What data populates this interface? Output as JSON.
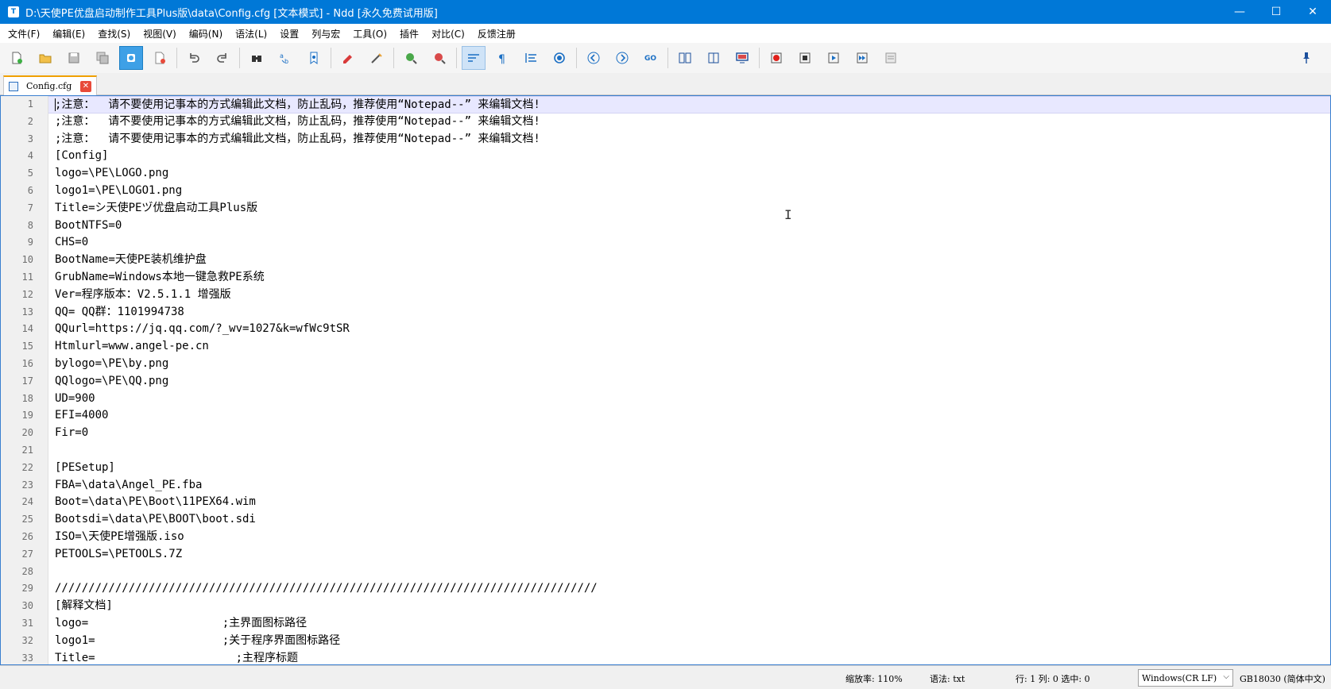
{
  "window": {
    "title": "D:\\天使PE优盘启动制作工具Plus版\\data\\Config.cfg [文本模式] - Ndd [永久免费试用版]",
    "app_icon": "T",
    "minimize": "—",
    "maximize": "☐",
    "close": "✕"
  },
  "menu": [
    "文件(F)",
    "编辑(E)",
    "查找(S)",
    "视图(V)",
    "编码(N)",
    "语法(L)",
    "设置",
    "列与宏",
    "工具(O)",
    "插件",
    "对比(C)",
    "反馈注册"
  ],
  "toolbar": {
    "icons": [
      "new-file-icon",
      "open-file-icon",
      "save-icon",
      "save-all-icon",
      "close-file-icon",
      "close-all-icon",
      "undo-icon",
      "redo-icon",
      "find-icon",
      "replace-icon",
      "bookmark-icon",
      "mark-icon",
      "clear-mark-icon",
      "zoom-in-icon",
      "zoom-out-icon",
      "word-wrap-icon",
      "show-symbols-icon",
      "indent-guide-icon",
      "file-monitor-icon",
      "prev-icon",
      "next-icon",
      "goto-icon",
      "compare-dir-icon",
      "compare-file-icon",
      "display-icon",
      "record-macro-icon",
      "stop-macro-icon",
      "play-macro-icon",
      "run-macro-multiple-icon",
      "save-macro-icon",
      "pin-icon"
    ]
  },
  "tab": {
    "label": "Config.cfg",
    "close": "✕"
  },
  "editor": {
    "lines": [
      ";注意：  请不要使用记事本的方式编辑此文档，防止乱码，推荐使用“Notepad--” 来编辑文档!",
      ";注意：  请不要使用记事本的方式编辑此文档，防止乱码，推荐使用“Notepad--” 来编辑文档!",
      ";注意：  请不要使用记事本的方式编辑此文档，防止乱码，推荐使用“Notepad--” 来编辑文档!",
      "[Config]",
      "logo=\\PE\\LOGO.png",
      "logo1=\\PE\\LOGO1.png",
      "Title=シ天使PEヅ优盘启动工具Plus版",
      "BootNTFS=0",
      "CHS=0",
      "BootName=天使PE装机维护盘",
      "GrubName=Windows本地一键急救PE系统",
      "Ver=程序版本：V2.5.1.1 增强版",
      "QQ= QQ群：1101994738",
      "QQurl=https://jq.qq.com/?_wv=1027&k=wfWc9tSR",
      "Htmlurl=www.angel-pe.cn",
      "bylogo=\\PE\\by.png",
      "QQlogo=\\PE\\QQ.png",
      "UD=900",
      "EFI=4000",
      "Fir=0",
      "",
      "[PESetup]",
      "FBA=\\data\\Angel_PE.fba",
      "Boot=\\data\\PE\\Boot\\11PEX64.wim",
      "Bootsdi=\\data\\PE\\BOOT\\boot.sdi",
      "ISO=\\天使PE增强版.iso",
      "PETOOLS=\\PETOOLS.7Z",
      "",
      "/////////////////////////////////////////////////////////////////////////////////",
      "[解释文档]",
      "logo=                    ;主界面图标路径",
      "logo1=                   ;关于程序界面图标路径",
      "Title=                     ;主程序标题"
    ],
    "line_numbers": [
      "1",
      "2",
      "3",
      "4",
      "5",
      "6",
      "7",
      "8",
      "9",
      "10",
      "11",
      "12",
      "13",
      "14",
      "15",
      "16",
      "17",
      "18",
      "19",
      "20",
      "21",
      "22",
      "23",
      "24",
      "25",
      "26",
      "27",
      "28",
      "29",
      "30",
      "31",
      "32",
      "33"
    ]
  },
  "status": {
    "zoom": "缩放率: 110%",
    "syntax": "语法: txt",
    "position": "行: 1 列: 0 选中: 0",
    "eol": "Windows(CR LF)",
    "encoding": "GB18030 (简体中文)"
  },
  "colors": {
    "title_bar": "#0078d7",
    "current_line": "#e8e8ff",
    "gutter": "#f0f0f0",
    "tab_accent": "#f0a000"
  }
}
